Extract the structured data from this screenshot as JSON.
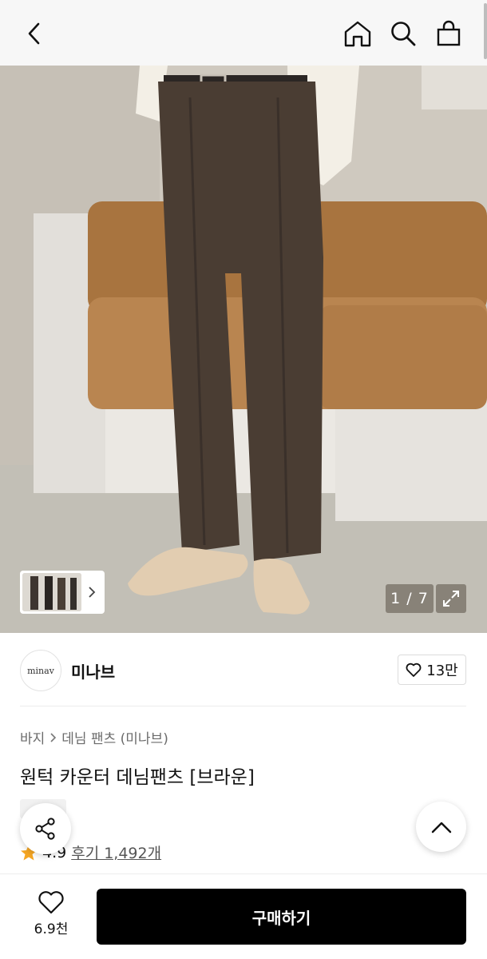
{
  "header": {
    "icons": [
      "chevron-left-icon",
      "home-icon",
      "search-icon",
      "shopping-bag-icon"
    ]
  },
  "gallery": {
    "counter": "1 / 7",
    "expand_icon": "expand-icon"
  },
  "brand": {
    "logo_text": "minav",
    "name": "미나브",
    "like_count": "13만"
  },
  "product": {
    "breadcrumb": [
      "바지",
      "데님 팬츠 (미나브)"
    ],
    "title": "원턱 카운터 데님팬츠 [브라운]",
    "rating": "4.9",
    "reviews": "후기 1,492개"
  },
  "bottom_bar": {
    "wish_count": "6.9천",
    "buy_label": "구매하기"
  },
  "colors": {
    "buy_button": "#000000",
    "star": "#f5a623",
    "header_bg": "#f7f7f7"
  }
}
